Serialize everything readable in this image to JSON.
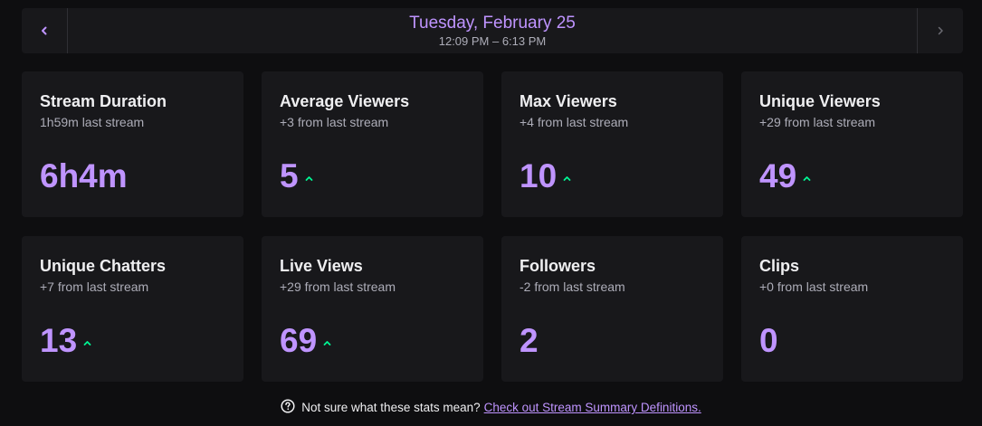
{
  "header": {
    "date": "Tuesday, February 25",
    "time_range": "12:09 PM – 6:13 PM",
    "prev_icon": "chevron-left-icon",
    "next_icon": "chevron-right-icon"
  },
  "colors": {
    "accent": "#bf94ff",
    "trend_up": "#00f593",
    "card_bg": "#18181b",
    "page_bg": "#0e0e10"
  },
  "stats": [
    {
      "title": "Stream Duration",
      "subtitle": "1h59m last stream",
      "value": "6h4m",
      "trend": "none"
    },
    {
      "title": "Average Viewers",
      "subtitle": "+3 from last stream",
      "value": "5",
      "trend": "up"
    },
    {
      "title": "Max Viewers",
      "subtitle": "+4 from last stream",
      "value": "10",
      "trend": "up"
    },
    {
      "title": "Unique Viewers",
      "subtitle": "+29 from last stream",
      "value": "49",
      "trend": "up"
    },
    {
      "title": "Unique Chatters",
      "subtitle": "+7 from last stream",
      "value": "13",
      "trend": "up"
    },
    {
      "title": "Live Views",
      "subtitle": "+29 from last stream",
      "value": "69",
      "trend": "up"
    },
    {
      "title": "Followers",
      "subtitle": "-2 from last stream",
      "value": "2",
      "trend": "none"
    },
    {
      "title": "Clips",
      "subtitle": "+0 from last stream",
      "value": "0",
      "trend": "none"
    }
  ],
  "footer": {
    "text": "Not sure what these stats mean?",
    "link_text": "Check out Stream Summary Definitions.",
    "icon": "help-circle-icon"
  }
}
